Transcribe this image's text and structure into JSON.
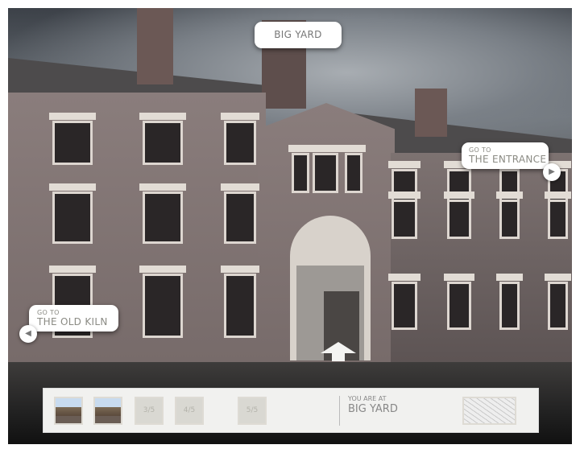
{
  "location_title": "BIG YARD",
  "nav": {
    "left": {
      "prefix": "GO TO",
      "destination": "THE OLD KILN",
      "icon": "arrow-left-icon"
    },
    "right": {
      "prefix": "GO TO",
      "destination": "THE ENTRANCE",
      "icon": "arrow-right-icon"
    },
    "forward_icon": "arrow-up-icon"
  },
  "bottom_bar": {
    "thumbnails": [
      {
        "label": "",
        "state": "visited"
      },
      {
        "label": "",
        "state": "visited"
      },
      {
        "label": "3/5",
        "state": "locked"
      },
      {
        "label": "4/5",
        "state": "locked"
      },
      {
        "label": "5/5",
        "state": "locked"
      }
    ],
    "you_are_at_label": "YOU ARE AT",
    "current_location": "BIG YARD",
    "map_icon": "map-icon"
  }
}
